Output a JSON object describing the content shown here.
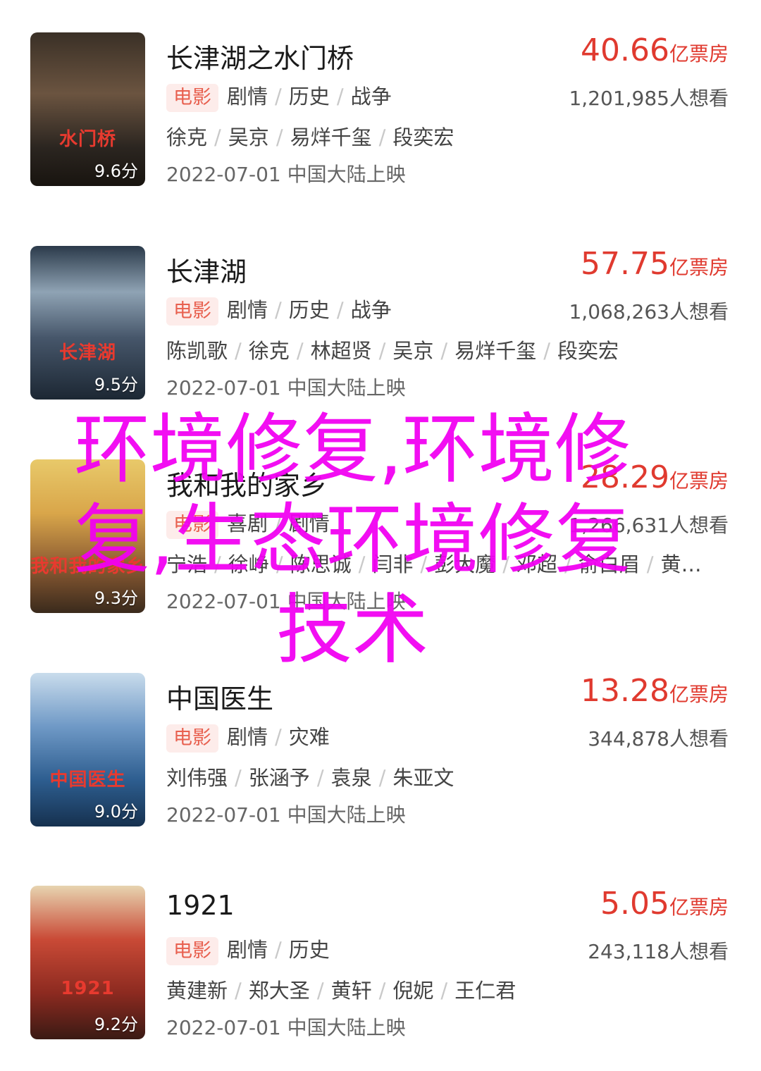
{
  "movies": [
    {
      "title": "长津湖之水门桥",
      "box_value": "40.66",
      "box_unit": "亿票房",
      "type_tag": "电影",
      "genres": [
        "剧情",
        "历史",
        "战争"
      ],
      "want": "1,201,985人想看",
      "cast": [
        "徐克",
        "吴京",
        "易烊千玺",
        "段奕宏"
      ],
      "release": "2022-07-01 中国大陆上映",
      "score": "9.6分",
      "poster_caption": "水门桥"
    },
    {
      "title": "长津湖",
      "box_value": "57.75",
      "box_unit": "亿票房",
      "type_tag": "电影",
      "genres": [
        "剧情",
        "历史",
        "战争"
      ],
      "want": "1,068,263人想看",
      "cast": [
        "陈凯歌",
        "徐克",
        "林超贤",
        "吴京",
        "易烊千玺",
        "段奕宏"
      ],
      "release": "2022-07-01 中国大陆上映",
      "score": "9.5分",
      "poster_caption": "长津湖"
    },
    {
      "title": "我和我的家乡",
      "box_value": "28.29",
      "box_unit": "亿票房",
      "type_tag": "电影",
      "genres": [
        "喜剧",
        "剧情"
      ],
      "want": "1,266,631人想看",
      "cast": [
        "宁浩",
        "徐峥",
        "陈思诚",
        "闫非",
        "彭大魔",
        "邓超",
        "俞白眉",
        "黄…"
      ],
      "release": "2022-07-01 中国大陆上映",
      "score": "9.3分",
      "poster_caption": "我和我的家乡"
    },
    {
      "title": "中国医生",
      "box_value": "13.28",
      "box_unit": "亿票房",
      "type_tag": "电影",
      "genres": [
        "剧情",
        "灾难"
      ],
      "want": "344,878人想看",
      "cast": [
        "刘伟强",
        "张涵予",
        "袁泉",
        "朱亚文"
      ],
      "release": "2022-07-01 中国大陆上映",
      "score": "9.0分",
      "poster_caption": "中国医生"
    },
    {
      "title": "1921",
      "box_value": "5.05",
      "box_unit": "亿票房",
      "type_tag": "电影",
      "genres": [
        "剧情",
        "历史"
      ],
      "want": "243,118人想看",
      "cast": [
        "黄建新",
        "郑大圣",
        "黄轩",
        "倪妮",
        "王仁君"
      ],
      "release": "2022-07-01 中国大陆上映",
      "score": "9.2分",
      "poster_caption": "1921"
    }
  ],
  "watermark": "环境修复,环境修复,生态环境修复技术",
  "colors": {
    "accent": "#e03a2f",
    "tag_bg": "#fdecea",
    "watermark": "#f200f2"
  }
}
